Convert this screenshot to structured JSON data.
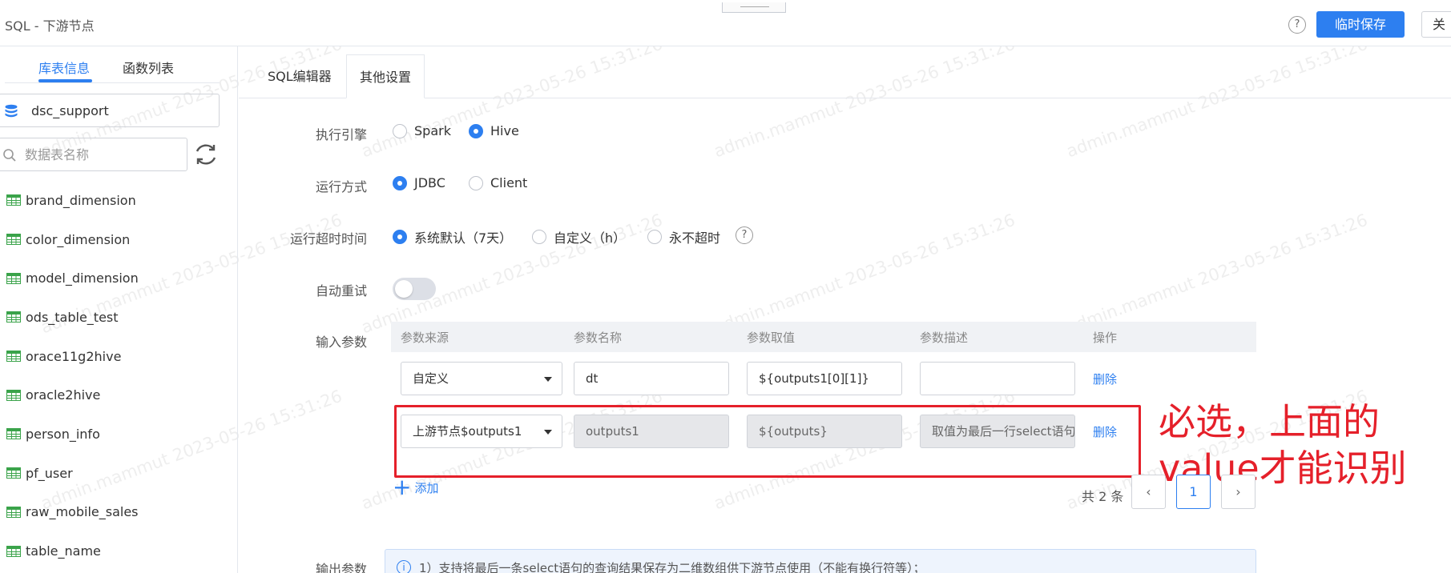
{
  "header": {
    "title": "SQL - 下游节点",
    "help_label": "?",
    "save_label": "临时保存",
    "close_label": "关"
  },
  "sidebar": {
    "tabs": [
      {
        "label": "库表信息",
        "active": true
      },
      {
        "label": "函数列表",
        "active": false
      }
    ],
    "database": "dsc_support",
    "search_placeholder": "数据表名称",
    "tables": [
      "brand_dimension",
      "color_dimension",
      "model_dimension",
      "ods_table_test",
      "orace11g2hive",
      "oracle2hive",
      "person_info",
      "pf_user",
      "raw_mobile_sales",
      "table_name"
    ]
  },
  "main": {
    "tabs": [
      {
        "label": "SQL编辑器",
        "active": false
      },
      {
        "label": "其他设置",
        "active": true
      }
    ],
    "engine": {
      "label": "执行引擎",
      "options": [
        {
          "label": "Spark",
          "checked": false
        },
        {
          "label": "Hive",
          "checked": true
        }
      ]
    },
    "run_mode": {
      "label": "运行方式",
      "options": [
        {
          "label": "JDBC",
          "checked": true
        },
        {
          "label": "Client",
          "checked": false
        }
      ]
    },
    "timeout": {
      "label": "运行超时时间",
      "options": [
        {
          "label": "系统默认（7天）",
          "checked": true
        },
        {
          "label": "自定义（h）",
          "checked": false
        },
        {
          "label": "永不超时",
          "checked": false
        }
      ],
      "help": "?"
    },
    "auto_retry": {
      "label": "自动重试",
      "enabled": false
    },
    "input_params": {
      "label": "输入参数",
      "columns": [
        "参数来源",
        "参数名称",
        "参数取值",
        "参数描述",
        "操作"
      ],
      "rows": [
        {
          "source": "自定义",
          "name": "dt",
          "value": "${outputs1[0][1]}",
          "desc": "",
          "action": "删除",
          "disabled": false
        },
        {
          "source": "上游节点$outputs1",
          "name": "outputs1",
          "value": "${outputs}",
          "desc": "取值为最后一行select语句",
          "action": "删除",
          "disabled": true
        }
      ],
      "add_label": "添加",
      "total": "共 2 条",
      "page": "1",
      "prev": "‹",
      "next": "›"
    },
    "output_params": {
      "label": "输出参数",
      "info": "1）支持将最后一条select语句的查询结果保存为二维数组供下游节点使用（不能有换行符等）；"
    },
    "annotation": [
      "必选，上面的",
      "value才能识别"
    ],
    "watermark": "admin.mammut 2023-05-26 15:31:26"
  },
  "colors": {
    "accent": "#2d7ff0",
    "annotation": "#e5202a"
  }
}
